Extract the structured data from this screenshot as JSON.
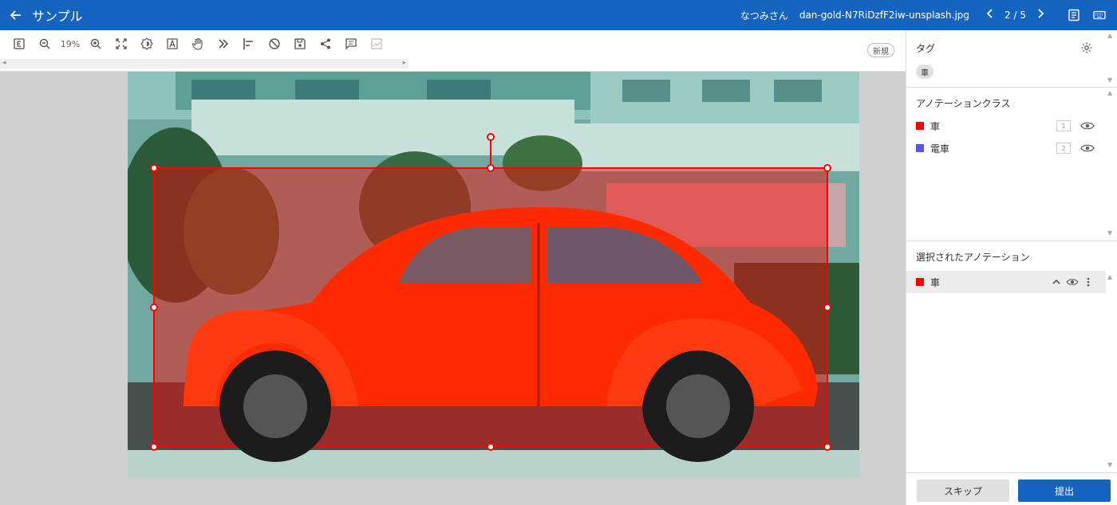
{
  "header": {
    "title": "サンプル",
    "user": "なつみさん",
    "filename": "dan-gold-N7RiDzfF2iw-unsplash.jpg",
    "pager": "2 / 5",
    "bg_color": "#1565c0"
  },
  "toolbar": {
    "zoom": "19%",
    "new_label": "新規",
    "tools": [
      "export-icon",
      "zoom-out-icon",
      "zoom-in-icon",
      "fit-screen-icon",
      "brightness-icon",
      "text-select-icon",
      "hand-pan-icon",
      "fast-forward-icon",
      "align-left-icon",
      "hide-icon",
      "save-icon",
      "share-icon",
      "comment-icon",
      "chart-icon"
    ]
  },
  "sidebar": {
    "tags_title": "タグ",
    "tags": [
      "車"
    ],
    "classes_title": "アノテーションクラス",
    "classes": [
      {
        "name": "車",
        "key": "1",
        "color": "#ff0000"
      },
      {
        "name": "電車",
        "key": "2",
        "color": "#5555ee"
      }
    ],
    "selected_title": "選択されたアノテーション",
    "selected": [
      {
        "name": "車",
        "color": "#ff0000"
      }
    ],
    "skip_label": "スキップ",
    "submit_label": "提出"
  }
}
